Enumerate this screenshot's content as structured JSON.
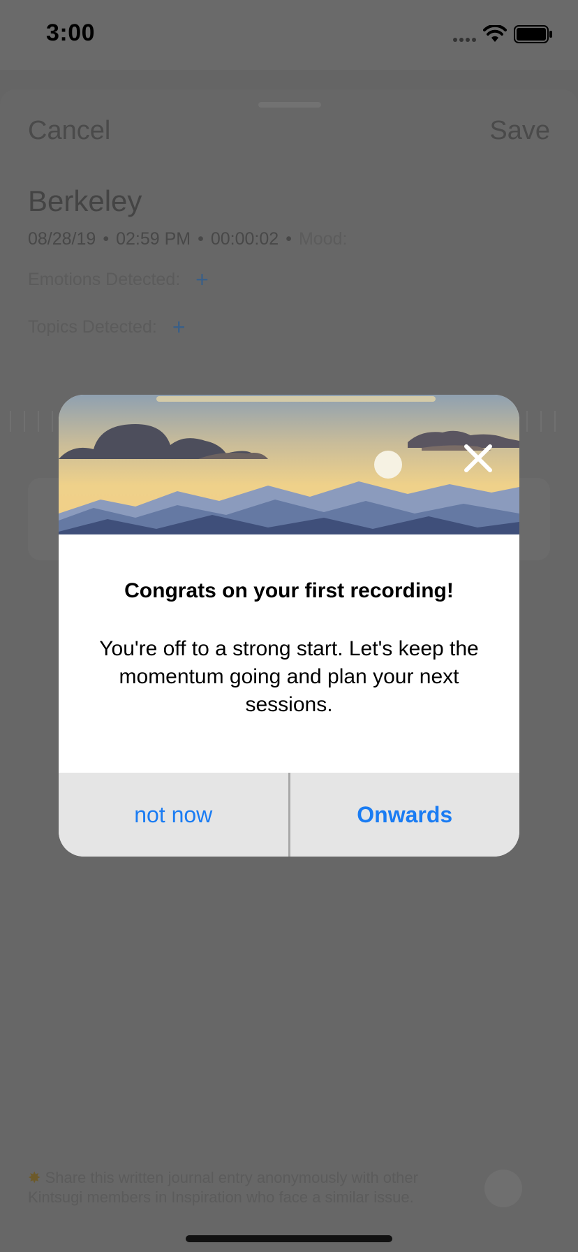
{
  "status_bar": {
    "time": "3:00"
  },
  "nav": {
    "cancel_label": "Cancel",
    "save_label": "Save"
  },
  "entry": {
    "title": "Berkeley",
    "date": "08/28/19",
    "time": "02:59 PM",
    "duration": "00:00:02",
    "mood_label": "Mood:",
    "separator": "•",
    "emotions_label": "Emotions Detected:",
    "topics_label": "Topics Detected:"
  },
  "share": {
    "text": "Share this written journal entry anonymously with other Kintsugi members in Inspiration who face a similar issue."
  },
  "modal": {
    "title": "Congrats on your first recording!",
    "body": "You're off to a strong start. Let's keep the momentum going and plan your next sessions.",
    "secondary_action": "not now",
    "primary_action": "Onwards"
  },
  "colors": {
    "overlay": "#656565",
    "accent": "#1a7cf3",
    "action_bar": "#e5e5e5"
  }
}
